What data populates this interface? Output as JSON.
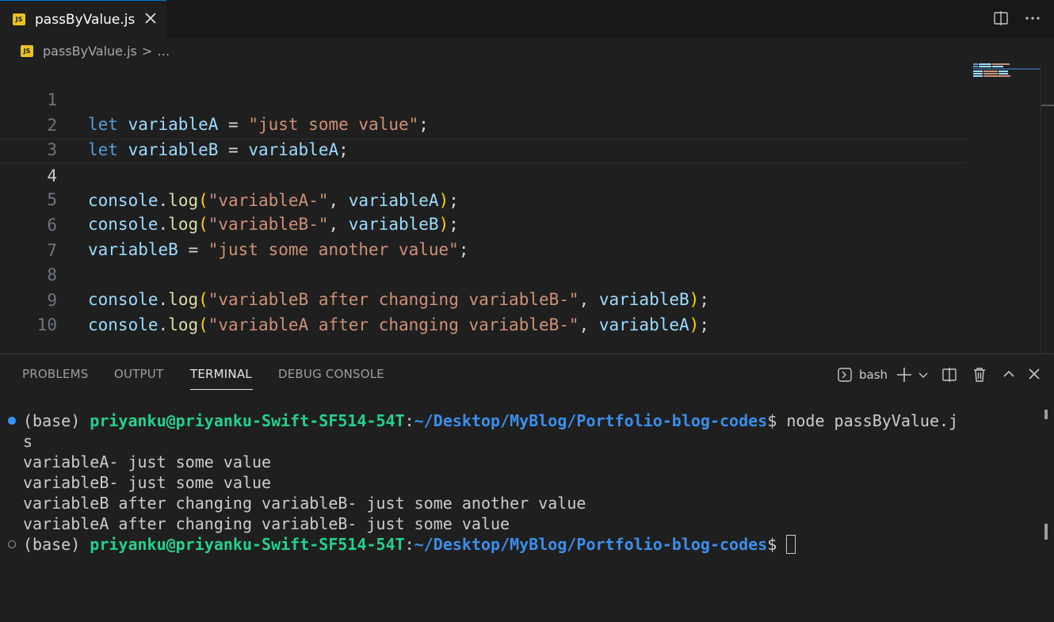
{
  "tab": {
    "icon": "JS",
    "label": "passByValue.js"
  },
  "breadcrumb": {
    "icon": "JS",
    "file": "passByValue.js",
    "separator": ">",
    "more": "…"
  },
  "editor": {
    "current_line": 4,
    "lines": [
      {
        "n": "1"
      },
      {
        "n": "2"
      },
      {
        "n": "3"
      },
      {
        "n": "4"
      },
      {
        "n": "5"
      },
      {
        "n": "6"
      },
      {
        "n": "7"
      },
      {
        "n": "8"
      },
      {
        "n": "9"
      },
      {
        "n": "10"
      }
    ],
    "tokens": {
      "let": "let",
      "variableA": "variableA",
      "variableB": "variableB",
      "eq": " = ",
      "semi": ";",
      "console": "console",
      "dot": ".",
      "log": "log",
      "lp": "(",
      "rp": ")",
      "comma": ", ",
      "str_just_some_value": "\"just some value\"",
      "str_varA": "\"variableA-\"",
      "str_varB": "\"variableB-\"",
      "str_another": "\"just some another value\"",
      "str_b_after": "\"variableB after changing variableB-\"",
      "str_a_after": "\"variableA after changing variableB-\""
    }
  },
  "panel": {
    "tabs": [
      "PROBLEMS",
      "OUTPUT",
      "TERMINAL",
      "DEBUG CONSOLE"
    ],
    "active_tab": "TERMINAL",
    "shell_label": "bash"
  },
  "terminal": {
    "prompt_env": "(base) ",
    "prompt_user": "priyanku@priyanku-Swift-SF514-54T",
    "prompt_colon": ":",
    "prompt_path": "~/Desktop/MyBlog/Portfolio-blog-codes",
    "prompt_dollar": "$ ",
    "command_part1": "node passByValue.j",
    "command_part2": "s",
    "output": [
      "variableA- just some value",
      "variableB- just some value",
      "variableB after changing variableB- just some another value",
      "variableA after changing variableB- just some value"
    ]
  },
  "colors": {
    "accent": "#0078d4",
    "js_badge": "#e8c225",
    "keyword": "#569cd6",
    "variable": "#9cdcfe",
    "string": "#ce9178",
    "function": "#dcdcaa",
    "bracket": "#ffd700",
    "terminal_user": "#23d18b",
    "terminal_path": "#3b8eea"
  }
}
